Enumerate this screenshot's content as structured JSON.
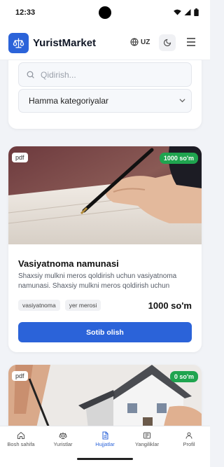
{
  "status_bar": {
    "time": "12:33"
  },
  "header": {
    "brand": "YuristMarket",
    "language": "UZ"
  },
  "filters": {
    "search_placeholder": "Qidirish...",
    "category_selected": "Hamma kategoriyalar"
  },
  "products": [
    {
      "type": "pdf",
      "price_badge": "1000 so'm",
      "title": "Vasiyatnoma namunasi",
      "description": "Shaxsiy mulkni meros qoldirish uchun vasiyatnoma namunasi. Shaxsiy mulkni meros qoldirish uchun vasiyatnoma namunasi.",
      "tags": [
        "vasiyatnoma",
        "yer merosi"
      ],
      "price": "1000 so'm",
      "button": "Sotib olish"
    },
    {
      "type": "pdf",
      "price_badge": "0 so'm"
    }
  ],
  "bottom_nav": [
    {
      "label": "Bosh sahifa",
      "icon": "home-icon"
    },
    {
      "label": "Yuristlar",
      "icon": "scales-icon"
    },
    {
      "label": "Hujjatlar",
      "icon": "document-icon",
      "active": true
    },
    {
      "label": "Yangiliklar",
      "icon": "newspaper-icon"
    },
    {
      "label": "Profil",
      "icon": "user-icon"
    }
  ],
  "colors": {
    "primary": "#2b63d9",
    "price_badge": "#1fa44f"
  }
}
